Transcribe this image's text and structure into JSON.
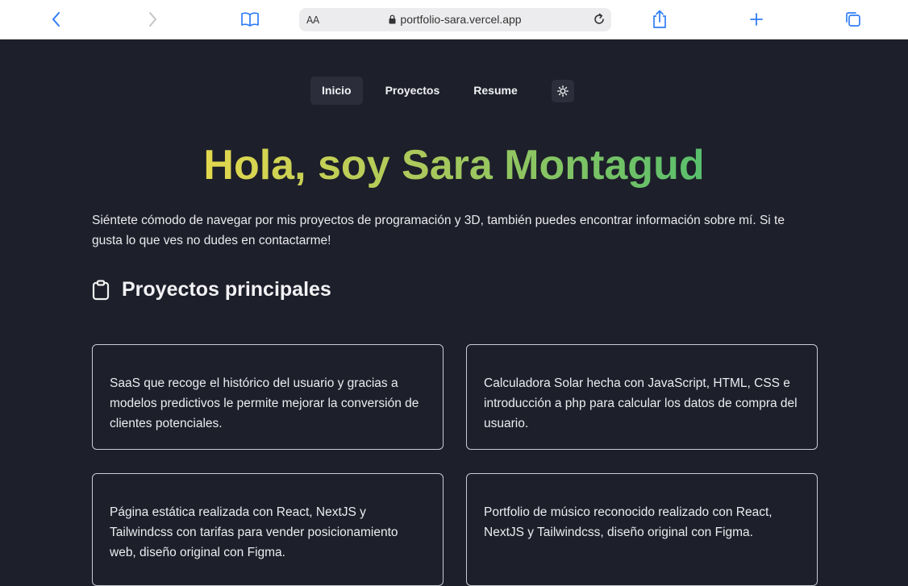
{
  "browser": {
    "reader_label": "AA",
    "url": "portfolio-sara.vercel.app"
  },
  "nav": {
    "items": [
      {
        "label": "Inicio"
      },
      {
        "label": "Proyectos"
      },
      {
        "label": "Resume"
      }
    ],
    "theme_icon": "sun-icon"
  },
  "hero": {
    "title": "Hola, soy Sara Montagud",
    "intro": "Siéntete cómodo de navegar por mis proyectos de programación y 3D, también puedes encontrar información sobre mí. Si te gusta lo que ves no dudes en contactarme!"
  },
  "projects": {
    "heading": "Proyectos principales",
    "icon": "clipboard-icon",
    "cards": [
      {
        "text": "SaaS que recoge el histórico del usuario y gracias a modelos predictivos le permite mejorar la conversión de clientes potenciales."
      },
      {
        "text": "Calculadora Solar hecha con JavaScript, HTML, CSS e introducción a php para calcular los datos de compra del usuario."
      },
      {
        "text": "Página estática realizada con React, NextJS y Tailwindcss con tarifas para vender posicionamiento web, diseño original con Figma."
      },
      {
        "text": "Portfolio de músico reconocido realizado con React, NextJS y Tailwindcss, diseño original con Figma."
      }
    ]
  },
  "colors": {
    "background": "#1d1f2a",
    "title_gradient_start": "#e3d84e",
    "title_gradient_end": "#58bf6c",
    "safari_accent": "#2f7cf6"
  }
}
